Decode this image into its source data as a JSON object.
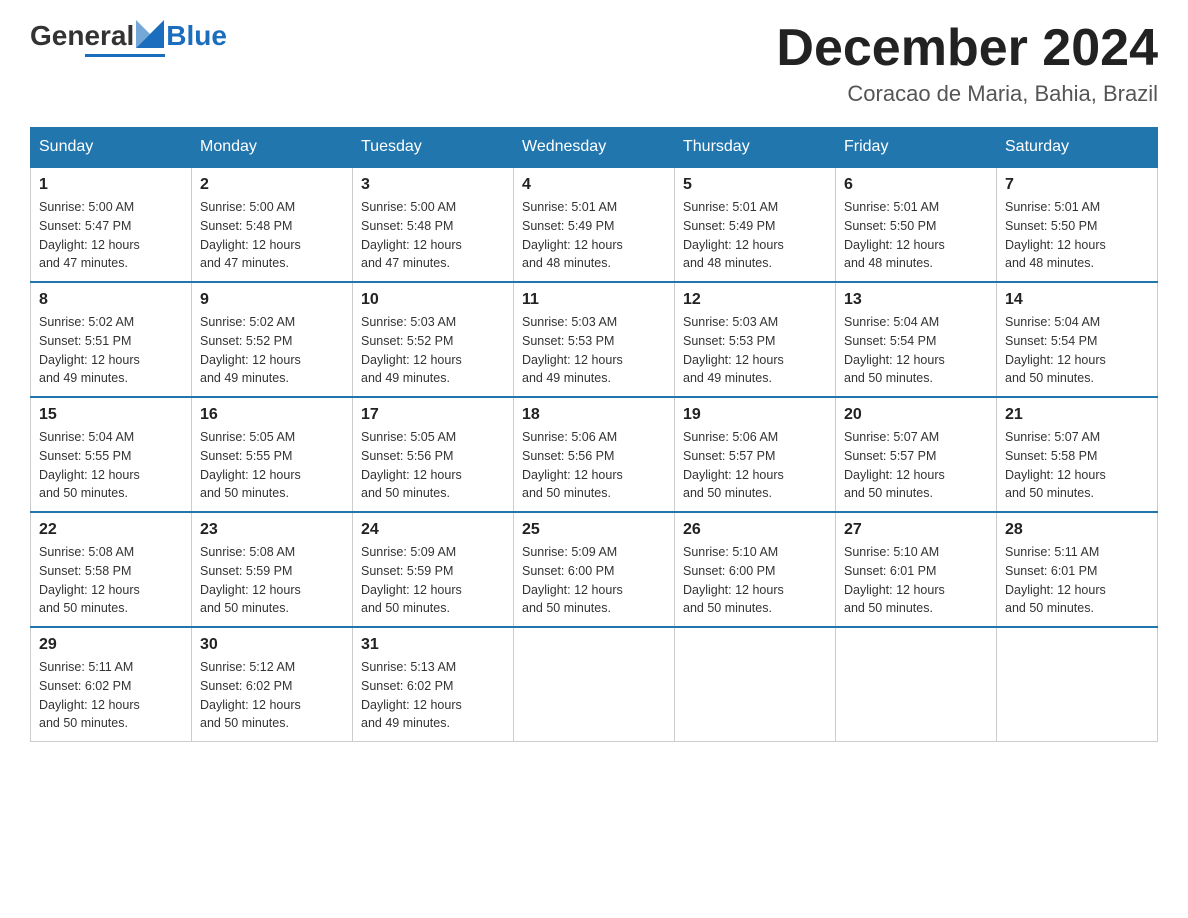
{
  "header": {
    "logo_general": "General",
    "logo_blue": "Blue",
    "month_title": "December 2024",
    "location": "Coracao de Maria, Bahia, Brazil"
  },
  "weekdays": [
    "Sunday",
    "Monday",
    "Tuesday",
    "Wednesday",
    "Thursday",
    "Friday",
    "Saturday"
  ],
  "weeks": [
    [
      {
        "day": "1",
        "sunrise": "5:00 AM",
        "sunset": "5:47 PM",
        "daylight": "12 hours and 47 minutes."
      },
      {
        "day": "2",
        "sunrise": "5:00 AM",
        "sunset": "5:48 PM",
        "daylight": "12 hours and 47 minutes."
      },
      {
        "day": "3",
        "sunrise": "5:00 AM",
        "sunset": "5:48 PM",
        "daylight": "12 hours and 47 minutes."
      },
      {
        "day": "4",
        "sunrise": "5:01 AM",
        "sunset": "5:49 PM",
        "daylight": "12 hours and 48 minutes."
      },
      {
        "day": "5",
        "sunrise": "5:01 AM",
        "sunset": "5:49 PM",
        "daylight": "12 hours and 48 minutes."
      },
      {
        "day": "6",
        "sunrise": "5:01 AM",
        "sunset": "5:50 PM",
        "daylight": "12 hours and 48 minutes."
      },
      {
        "day": "7",
        "sunrise": "5:01 AM",
        "sunset": "5:50 PM",
        "daylight": "12 hours and 48 minutes."
      }
    ],
    [
      {
        "day": "8",
        "sunrise": "5:02 AM",
        "sunset": "5:51 PM",
        "daylight": "12 hours and 49 minutes."
      },
      {
        "day": "9",
        "sunrise": "5:02 AM",
        "sunset": "5:52 PM",
        "daylight": "12 hours and 49 minutes."
      },
      {
        "day": "10",
        "sunrise": "5:03 AM",
        "sunset": "5:52 PM",
        "daylight": "12 hours and 49 minutes."
      },
      {
        "day": "11",
        "sunrise": "5:03 AM",
        "sunset": "5:53 PM",
        "daylight": "12 hours and 49 minutes."
      },
      {
        "day": "12",
        "sunrise": "5:03 AM",
        "sunset": "5:53 PM",
        "daylight": "12 hours and 49 minutes."
      },
      {
        "day": "13",
        "sunrise": "5:04 AM",
        "sunset": "5:54 PM",
        "daylight": "12 hours and 50 minutes."
      },
      {
        "day": "14",
        "sunrise": "5:04 AM",
        "sunset": "5:54 PM",
        "daylight": "12 hours and 50 minutes."
      }
    ],
    [
      {
        "day": "15",
        "sunrise": "5:04 AM",
        "sunset": "5:55 PM",
        "daylight": "12 hours and 50 minutes."
      },
      {
        "day": "16",
        "sunrise": "5:05 AM",
        "sunset": "5:55 PM",
        "daylight": "12 hours and 50 minutes."
      },
      {
        "day": "17",
        "sunrise": "5:05 AM",
        "sunset": "5:56 PM",
        "daylight": "12 hours and 50 minutes."
      },
      {
        "day": "18",
        "sunrise": "5:06 AM",
        "sunset": "5:56 PM",
        "daylight": "12 hours and 50 minutes."
      },
      {
        "day": "19",
        "sunrise": "5:06 AM",
        "sunset": "5:57 PM",
        "daylight": "12 hours and 50 minutes."
      },
      {
        "day": "20",
        "sunrise": "5:07 AM",
        "sunset": "5:57 PM",
        "daylight": "12 hours and 50 minutes."
      },
      {
        "day": "21",
        "sunrise": "5:07 AM",
        "sunset": "5:58 PM",
        "daylight": "12 hours and 50 minutes."
      }
    ],
    [
      {
        "day": "22",
        "sunrise": "5:08 AM",
        "sunset": "5:58 PM",
        "daylight": "12 hours and 50 minutes."
      },
      {
        "day": "23",
        "sunrise": "5:08 AM",
        "sunset": "5:59 PM",
        "daylight": "12 hours and 50 minutes."
      },
      {
        "day": "24",
        "sunrise": "5:09 AM",
        "sunset": "5:59 PM",
        "daylight": "12 hours and 50 minutes."
      },
      {
        "day": "25",
        "sunrise": "5:09 AM",
        "sunset": "6:00 PM",
        "daylight": "12 hours and 50 minutes."
      },
      {
        "day": "26",
        "sunrise": "5:10 AM",
        "sunset": "6:00 PM",
        "daylight": "12 hours and 50 minutes."
      },
      {
        "day": "27",
        "sunrise": "5:10 AM",
        "sunset": "6:01 PM",
        "daylight": "12 hours and 50 minutes."
      },
      {
        "day": "28",
        "sunrise": "5:11 AM",
        "sunset": "6:01 PM",
        "daylight": "12 hours and 50 minutes."
      }
    ],
    [
      {
        "day": "29",
        "sunrise": "5:11 AM",
        "sunset": "6:02 PM",
        "daylight": "12 hours and 50 minutes."
      },
      {
        "day": "30",
        "sunrise": "5:12 AM",
        "sunset": "6:02 PM",
        "daylight": "12 hours and 50 minutes."
      },
      {
        "day": "31",
        "sunrise": "5:13 AM",
        "sunset": "6:02 PM",
        "daylight": "12 hours and 49 minutes."
      },
      null,
      null,
      null,
      null
    ]
  ],
  "labels": {
    "sunrise": "Sunrise:",
    "sunset": "Sunset:",
    "daylight": "Daylight:"
  }
}
